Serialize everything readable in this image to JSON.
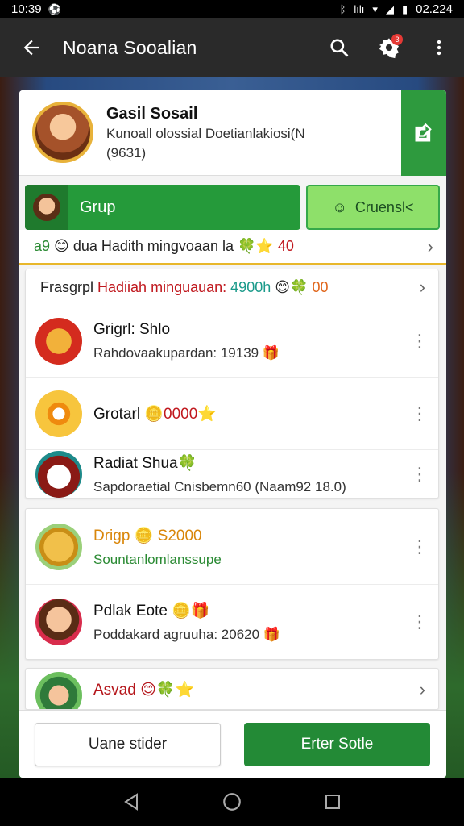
{
  "status_bar": {
    "time_left": "10:39",
    "time_right": "02.224",
    "network_label": "lılı"
  },
  "app_bar": {
    "title": "Noana Sooalian",
    "notification_count": "3"
  },
  "profile": {
    "name": "Gasil Sosail",
    "subtitle": "Kunoall olossial Doetianlakiosi(N",
    "count": "(9631)"
  },
  "buttons": {
    "group": "Grup",
    "create": "Cruensl<"
  },
  "rows": {
    "row_a": {
      "prefix": "a9",
      "text": "dua Hadith mingvoaan la",
      "value": "40"
    },
    "row_b": {
      "part1": "Frasgrpl",
      "part2": "Hadiiah minguauan:",
      "part3": "4900h",
      "part4": "00"
    }
  },
  "list_1": [
    {
      "title": "Grigrl: Shlo",
      "subtitle": "Rahdovaakupardan: 19139"
    },
    {
      "title": "Grotarl",
      "title_value": "0000"
    },
    {
      "title": "Radiat Shua",
      "subtitle": "Sapdoraetial Cnisbemn60 (Naam92 18.0)"
    }
  ],
  "list_2": [
    {
      "title": "Drigp",
      "title_value": "S2000",
      "subtitle": "Sountanlomlanssupe"
    },
    {
      "title": "Pdlak Eote",
      "subtitle": "Poddakard agruuha: 20620"
    }
  ],
  "list_3": [
    {
      "title": "Asvad"
    }
  ],
  "footer": {
    "secondary": "Uane stider",
    "primary": "Erter Sotle"
  },
  "colors": {
    "primary_green": "#238a36",
    "app_bar": "#2a2a2a",
    "accent_yellow": "#e8b72b",
    "badge_red": "#e53935"
  },
  "icons": [
    "back-arrow-icon",
    "search-icon",
    "settings-gear-icon",
    "more-vert-icon",
    "edit-icon",
    "chevron-right-icon",
    "back-nav-icon",
    "home-nav-icon",
    "recents-nav-icon"
  ]
}
